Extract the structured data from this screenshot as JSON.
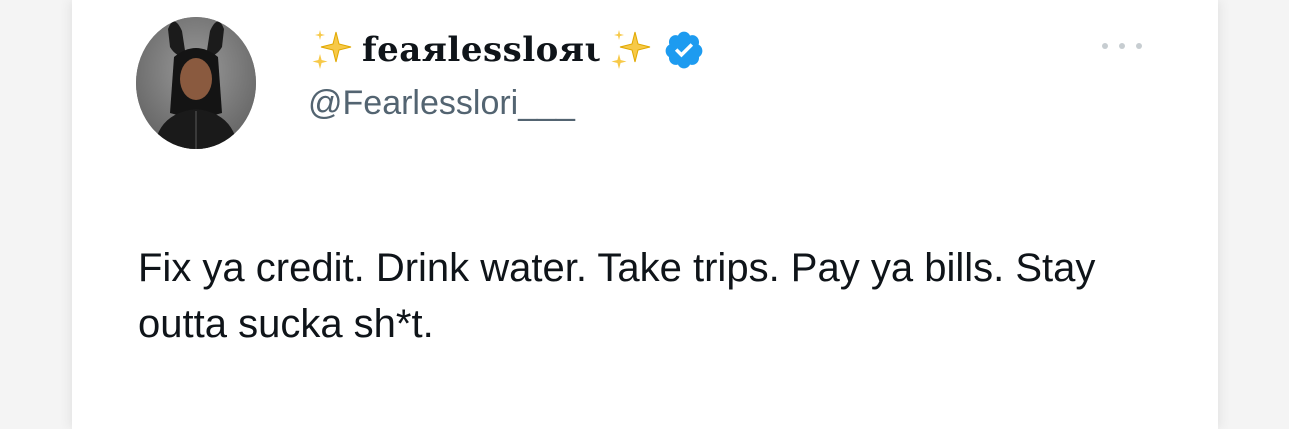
{
  "tweet": {
    "display_name": "feaяlessloяι",
    "handle": "@Fearlesslori___",
    "verified": true,
    "text": "Fix ya credit. Drink water. Take trips. Pay ya bills. Stay outta sucka sh*t.",
    "avatar_icon": "profile-photo",
    "sparkle_icon": "sparkles-emoji",
    "verified_icon": "verified-badge-icon",
    "more_icon": "more-options-icon"
  },
  "colors": {
    "verified_blue": "#1d9bf0",
    "text_primary": "#0f1419",
    "text_secondary": "#536471",
    "sparkle_yellow": "#f7c948"
  }
}
